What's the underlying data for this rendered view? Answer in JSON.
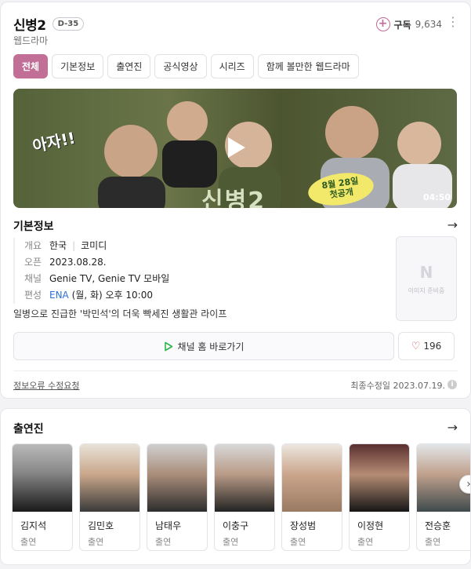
{
  "header": {
    "title": "신병2",
    "dday": "D-35",
    "genre": "웹드라마",
    "subscribe_label": "구독",
    "subscribe_count": "9,634",
    "more_icon": "more-vertical-icon"
  },
  "tabs": [
    {
      "label": "전체",
      "active": true
    },
    {
      "label": "기본정보",
      "active": false
    },
    {
      "label": "출연진",
      "active": false
    },
    {
      "label": "공식영상",
      "active": false
    },
    {
      "label": "시리즈",
      "active": false
    },
    {
      "label": "함께 볼만한 웹드라마",
      "active": false
    }
  ],
  "video": {
    "duration": "04:50",
    "overlay_text_left": "아자!!",
    "overlay_badge_line1": "8월 28일",
    "overlay_badge_line2": "첫공개",
    "overlay_logo": "신병2"
  },
  "basic_info": {
    "title": "기본정보",
    "rows": [
      {
        "label": "개요",
        "values": [
          "한국",
          "코미디"
        ]
      },
      {
        "label": "오픈",
        "values": [
          "2023.08.28."
        ]
      },
      {
        "label": "채널",
        "values": [
          "Genie TV, Genie TV 모바일"
        ]
      },
      {
        "label": "편성",
        "link": "ENA",
        "values": [
          " (월, 화) 오후 10:00"
        ]
      }
    ],
    "description": "일병으로 진급한 '박민석'의 더욱 빡세진 생활관 라이프",
    "poster_placeholder_logo": "N",
    "poster_placeholder_text": "이미지 준비중"
  },
  "actions": {
    "channel_button": "채널 홈 바로가기",
    "like_count": "196"
  },
  "footer": {
    "report_link": "정보오류 수정요청",
    "updated": "최종수정일 2023.07.19."
  },
  "cast": {
    "title": "출연진",
    "members": [
      {
        "name": "김지석",
        "role": "출연"
      },
      {
        "name": "김민호",
        "role": "출연"
      },
      {
        "name": "남태우",
        "role": "출연"
      },
      {
        "name": "이충구",
        "role": "출연"
      },
      {
        "name": "장성범",
        "role": "출연"
      },
      {
        "name": "이정현",
        "role": "출연"
      },
      {
        "name": "전승훈",
        "role": "출연"
      }
    ]
  },
  "colors": {
    "accent": "#c26f98",
    "link": "#2d6fd8",
    "heart": "#e0455a",
    "play_green": "#2fb34a"
  }
}
